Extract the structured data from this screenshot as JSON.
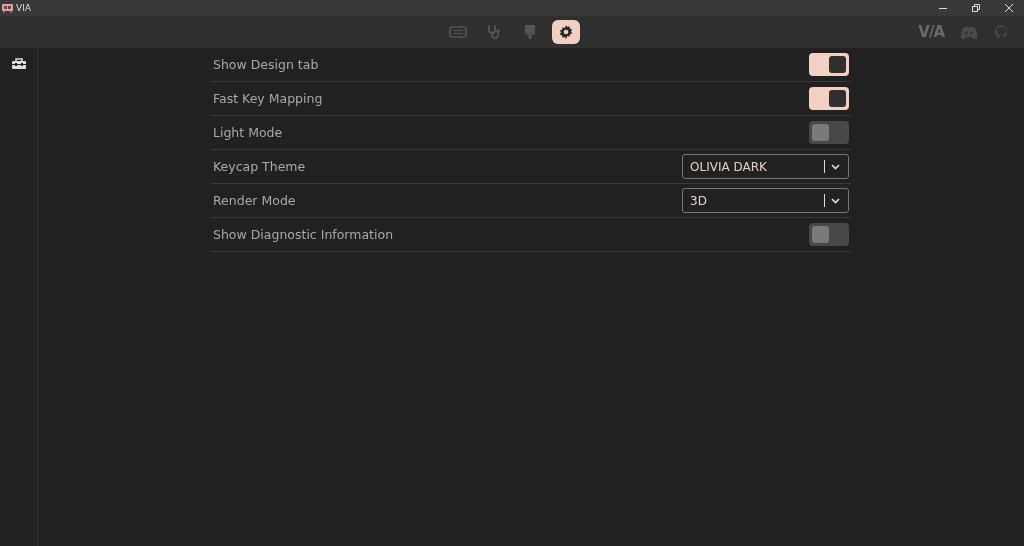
{
  "window": {
    "title": "VIA"
  },
  "nav_tabs": [
    {
      "kind": "keyboard",
      "selected": false
    },
    {
      "kind": "stethoscope",
      "selected": false
    },
    {
      "kind": "brush",
      "selected": false
    },
    {
      "kind": "gear",
      "selected": true
    }
  ],
  "nav_logo": "V/A",
  "settings": [
    {
      "label": "Show Design tab",
      "kind": "toggle",
      "on": true
    },
    {
      "label": "Fast Key Mapping",
      "kind": "toggle",
      "on": true
    },
    {
      "label": "Light Mode",
      "kind": "toggle",
      "on": false
    },
    {
      "label": "Keycap Theme",
      "kind": "select",
      "value": "OLIVIA DARK"
    },
    {
      "label": "Render Mode",
      "kind": "select",
      "value": "3D"
    },
    {
      "label": "Show Diagnostic Information",
      "kind": "toggle",
      "on": false
    }
  ]
}
